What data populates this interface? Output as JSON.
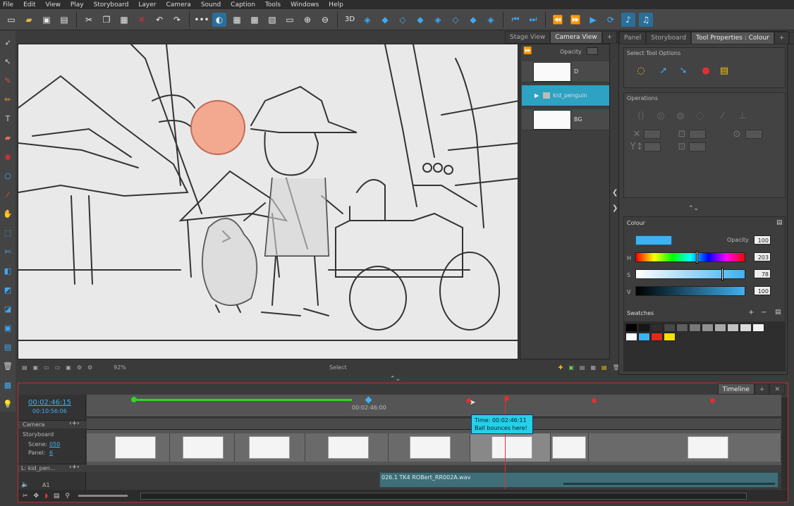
{
  "menu": [
    "File",
    "Edit",
    "View",
    "Play",
    "Storyboard",
    "Layer",
    "Camera",
    "Sound",
    "Caption",
    "Tools",
    "Windows",
    "Help"
  ],
  "toolbar_icons": [
    "new-icon",
    "open-icon",
    "save-icon",
    "save-all-icon",
    "cut-icon",
    "copy-icon",
    "paste-icon",
    "delete-icon",
    "undo-icon",
    "redo-icon",
    "more-icon",
    "onion-icon",
    "grid-icon",
    "grid-alt-icon",
    "light-table-icon",
    "safe-area-icon",
    "zoom-in-icon",
    "zoom-out-icon",
    "3d-icon",
    "camera-icon",
    "new-panel-icon",
    "duplicate-panel-icon",
    "split-panel-icon",
    "smart-panel-icon",
    "transition-icon",
    "prev-icon",
    "next-icon",
    "first-icon",
    "play-icon",
    "loop-icon",
    "sound-icon",
    "sound-scrub-icon"
  ],
  "view_tabs": {
    "stage": "Stage View",
    "camera": "Camera View"
  },
  "layers": {
    "opacity_label": "Opacity",
    "items": [
      {
        "name": "D"
      },
      {
        "name": "kid_penguin"
      },
      {
        "name": "BG"
      }
    ]
  },
  "stage_bar": {
    "zoom": "92%",
    "status": "Select"
  },
  "right_tabs": [
    "Panel",
    "Storyboard",
    "Tool Properties : Colour"
  ],
  "tool_props": {
    "select_title": "Select Tool Options",
    "operations_title": "Operations"
  },
  "colour": {
    "title": "Colour",
    "opacity_label": "Opacity",
    "opacity": "100",
    "swatch_color": "#3fb1f0",
    "h_label": "H",
    "h": "203",
    "s_label": "S",
    "s": "78",
    "v_label": "V",
    "v": "100"
  },
  "swatches": {
    "title": "Swatches",
    "colors": [
      "#000000",
      "#161616",
      "#2e2e2e",
      "#474747",
      "#5f5f5f",
      "#787878",
      "#909090",
      "#a9a9a9",
      "#c1c1c1",
      "#dadada",
      "#f2f2f2",
      "#ffffff",
      "#3fb1f0",
      "#e02a1e",
      "#f4e10d"
    ]
  },
  "timeline": {
    "tab": "Timeline",
    "timecode": "00:02:46:15",
    "duration": "00:10:56:06",
    "ruler_marker": "00:02:46:00",
    "camera_label": "Camera",
    "storyboard_label": "Storyboard",
    "scene_label": "Scene:",
    "scene_value": "050",
    "panel_label": "Panel:",
    "panel_value": "6",
    "layer_track": "L: kid_pen...",
    "audio_track": "A1",
    "audio_clip": "026.1 TK4 ROBert_RR002A.wav",
    "tooltip_time": "Time: 00:02:46:11",
    "tooltip_note": "Ball bounces here!"
  }
}
